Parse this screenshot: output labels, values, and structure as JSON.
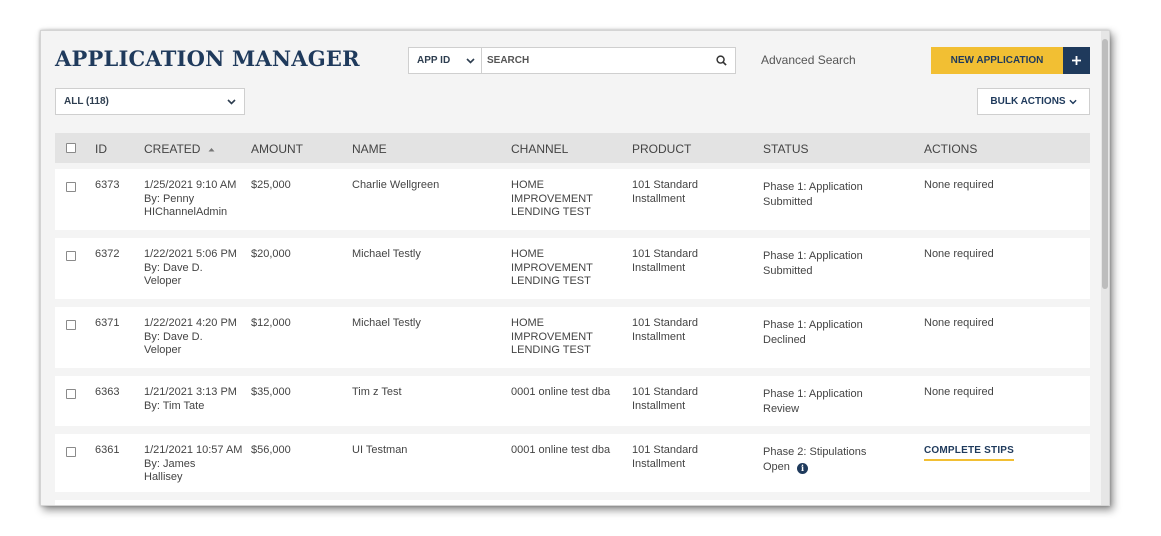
{
  "page": {
    "title": "APPLICATION MANAGER"
  },
  "search": {
    "type_value": "APP ID",
    "placeholder": "SEARCH",
    "advanced_label": "Advanced Search"
  },
  "toolbar": {
    "new_application_label": "NEW APPLICATION",
    "plus_label": "+",
    "filter_value": "ALL (118)",
    "bulk_actions_label": "BULK ACTIONS"
  },
  "table": {
    "columns": {
      "id": "ID",
      "created": "CREATED",
      "amount": "AMOUNT",
      "name": "NAME",
      "channel": "CHANNEL",
      "product": "PRODUCT",
      "status": "STATUS",
      "actions": "ACTIONS"
    },
    "rows": [
      {
        "id": "6373",
        "created_date": "1/25/2021 9:10 AM",
        "created_by": "By: Penny\nHIChannelAdmin",
        "amount": "$25,000",
        "name": "Charlie Wellgreen",
        "channel": "HOME\nIMPROVEMENT\nLENDING TEST",
        "product": "101 Standard\nInstallment",
        "status": "Phase 1: Application\nSubmitted",
        "action": "None required"
      },
      {
        "id": "6372",
        "created_date": "1/22/2021 5:06 PM",
        "created_by": "By: Dave D.\nVeloper",
        "amount": "$20,000",
        "name": "Michael Testly",
        "channel": "HOME\nIMPROVEMENT\nLENDING TEST",
        "product": "101 Standard\nInstallment",
        "status": "Phase 1: Application\nSubmitted",
        "action": "None required"
      },
      {
        "id": "6371",
        "created_date": "1/22/2021 4:20 PM",
        "created_by": "By: Dave D.\nVeloper",
        "amount": "$12,000",
        "name": "Michael Testly",
        "channel": "HOME\nIMPROVEMENT\nLENDING TEST",
        "product": "101 Standard\nInstallment",
        "status": "Phase 1: Application\nDeclined",
        "action": "None required"
      },
      {
        "id": "6363",
        "created_date": "1/21/2021 3:13 PM",
        "created_by": "By: Tim Tate",
        "amount": "$35,000",
        "name": "Tim z Test",
        "channel": "0001 online test dba",
        "product": "101 Standard\nInstallment",
        "status": "Phase 1: Application\nReview",
        "action": "None required"
      },
      {
        "id": "6361",
        "created_date": "1/21/2021 10:57 AM",
        "created_by": "By: James\nHallisey",
        "amount": "$56,000",
        "name": "UI Testman",
        "channel": "0001 online test dba",
        "product": "101 Standard\nInstallment",
        "status_line1": "Phase 2: Stipulations",
        "status_line2": "Open",
        "info_glyph": "i",
        "action_link": "COMPLETE STIPS"
      }
    ]
  },
  "colors": {
    "brand_navy": "#1f3a5c",
    "accent_yellow": "#f2bf33",
    "header_gray": "#e3e3e3",
    "page_bg": "#f4f4f4"
  }
}
